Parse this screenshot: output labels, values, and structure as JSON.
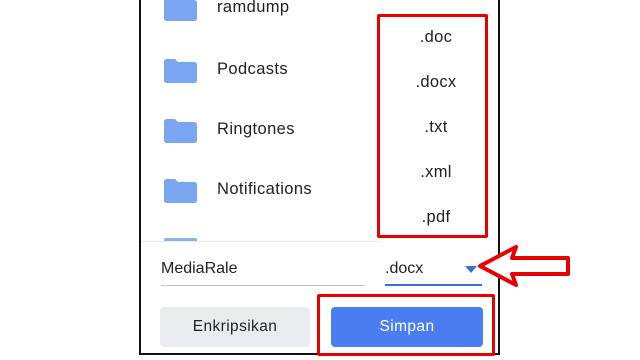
{
  "folders": [
    {
      "label": "ramdump",
      "icon": "folder-icon"
    },
    {
      "label": "Podcasts",
      "icon": "folder-icon"
    },
    {
      "label": "Ringtones",
      "icon": "folder-icon"
    },
    {
      "label": "Notifications",
      "icon": "folder-icon"
    }
  ],
  "file_types": [
    ".doc",
    ".docx",
    ".txt",
    ".xml",
    ".pdf"
  ],
  "filename": {
    "value": "MediaRale"
  },
  "file_type_select": {
    "value": ".docx",
    "icon": "caret-down-icon"
  },
  "buttons": {
    "encrypt": "Enkripsikan",
    "save": "Simpan"
  },
  "colors": {
    "folder": "#7aa5f0",
    "accent": "#4a7ef0",
    "annotation": "#e60000",
    "secondary_button": "#e9ebee"
  }
}
